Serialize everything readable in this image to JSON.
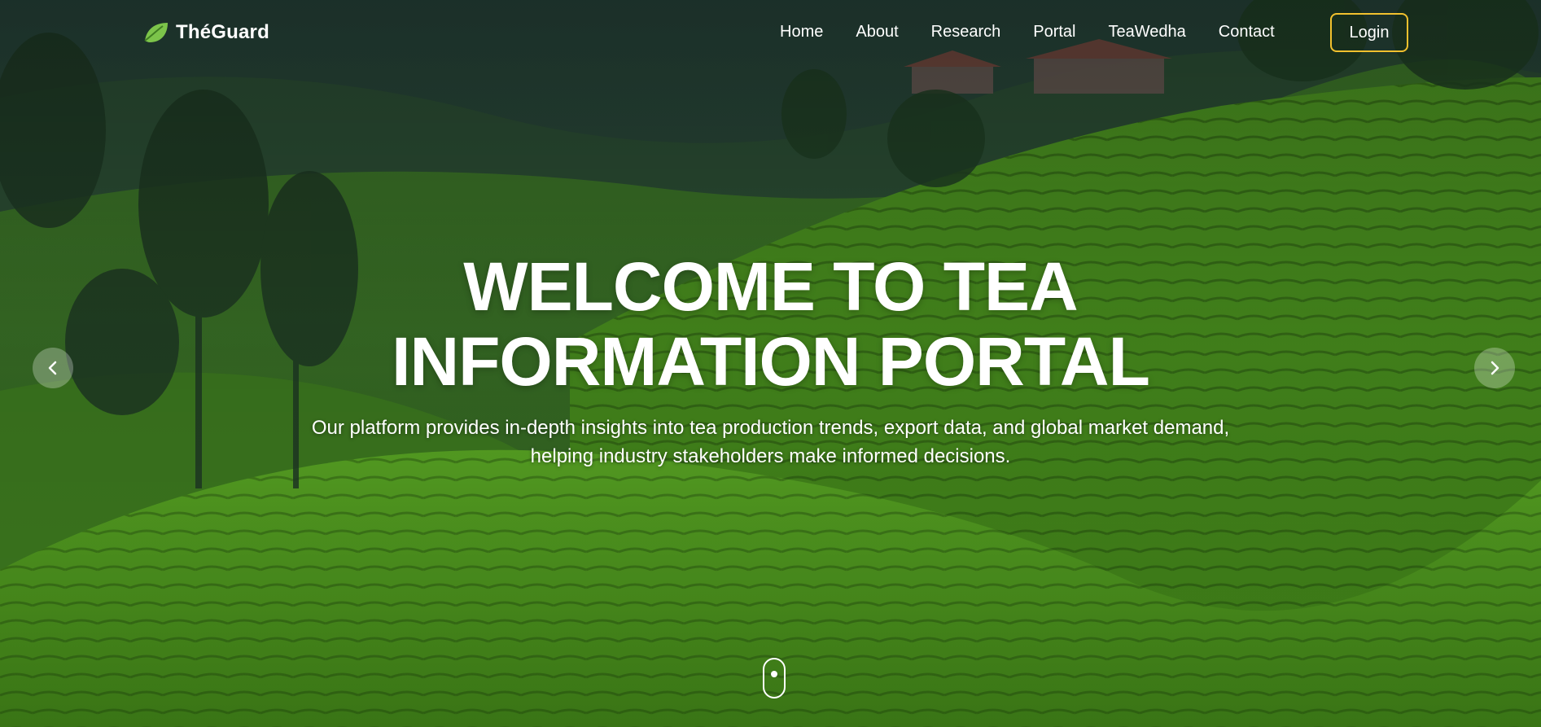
{
  "brand": {
    "name": "ThéGuard",
    "icon": "leaf-icon"
  },
  "nav": {
    "links": [
      "Home",
      "About",
      "Research",
      "Portal",
      "TeaWedha",
      "Contact"
    ],
    "login_label": "Login"
  },
  "hero": {
    "title_line1": "WELCOME TO TEA",
    "title_line2": "INFORMATION PORTAL",
    "subtitle_line1": "Our platform provides in-depth insights into tea production trends, export data, and global market demand,",
    "subtitle_line2": "helping industry stakeholders make informed decisions."
  },
  "carousel": {
    "prev_icon": "chevron-left-icon",
    "next_icon": "chevron-right-icon"
  },
  "scroll_indicator": {
    "icon": "mouse-scroll-icon"
  },
  "colors": {
    "login_border": "#f2c12e",
    "leaf": "#7cc44a"
  }
}
